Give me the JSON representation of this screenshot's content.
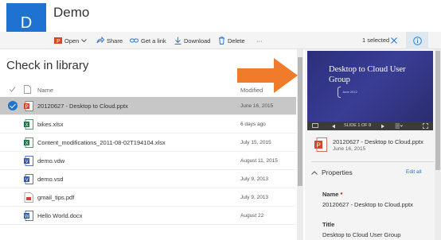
{
  "site": {
    "logo_letter": "D",
    "title": "Demo"
  },
  "commands": {
    "open": "Open",
    "share": "Share",
    "get_link": "Get a link",
    "download": "Download",
    "delete": "Delete",
    "more": "···",
    "selected": "1 selected"
  },
  "library": {
    "title": "Check in library",
    "columns": {
      "name": "Name",
      "modified": "Modified"
    },
    "rows": [
      {
        "name": "20120627 - Desktop to Cloud.pptx",
        "modified": "June 16, 2015",
        "type": "pptx",
        "selected": true
      },
      {
        "name": "bikes.xlsx",
        "modified": "6 days ago",
        "type": "xlsx",
        "selected": false
      },
      {
        "name": "Content_modifications_2011-08-02T194104.xlsx",
        "modified": "July 15, 2015",
        "type": "xlsx",
        "selected": false
      },
      {
        "name": "demo.vdw",
        "modified": "August 11, 2015",
        "type": "vdw",
        "selected": false
      },
      {
        "name": "demo.vsd",
        "modified": "July 9, 2013",
        "type": "vsd",
        "selected": false
      },
      {
        "name": "gmail_tips.pdf",
        "modified": "July 9, 2013",
        "type": "pdf",
        "selected": false
      },
      {
        "name": "Hello World.docx",
        "modified": "August 22",
        "type": "docx",
        "selected": false
      }
    ]
  },
  "details": {
    "preview_title": "Desktop to Cloud User Group",
    "preview_subtitle": "June 2012",
    "slide_indicator": "SLIDE 1 OF 8",
    "file_name": "20120627 - Desktop to Cloud.pptx",
    "file_date": "June 16, 2015",
    "properties_heading": "Properties",
    "edit_all": "Edit all",
    "props": [
      {
        "label": "Name",
        "required": "*",
        "value": "20120627 - Desktop to Cloud.pptx"
      },
      {
        "label": "Title",
        "required": "",
        "value": "Desktop to Cloud User Group"
      }
    ]
  },
  "colors": {
    "accent": "#1e73d2",
    "arrow": "#f07c2b",
    "selected_row": "#c7c7c7"
  }
}
